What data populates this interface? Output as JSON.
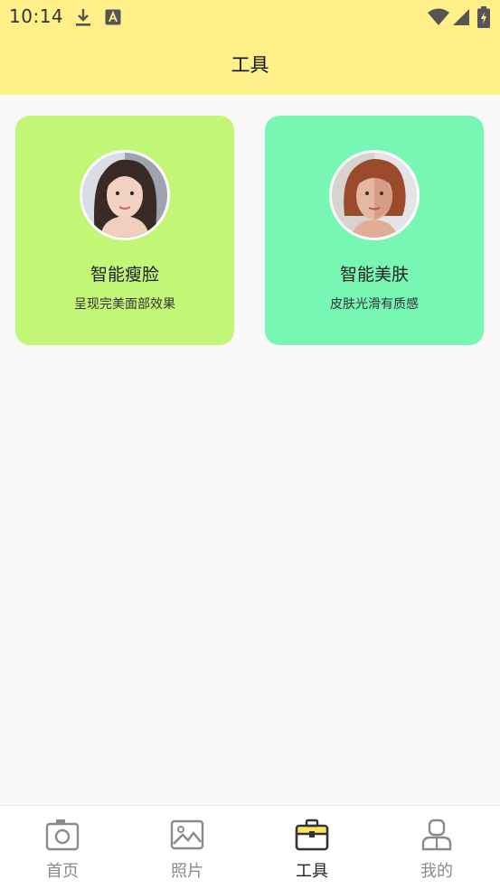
{
  "status_bar": {
    "time": "10:14",
    "icons": [
      "download-icon",
      "text-a-icon",
      "wifi-icon",
      "signal-icon",
      "battery-charging-icon"
    ]
  },
  "header": {
    "title": "工具"
  },
  "tools": [
    {
      "title": "智能瘦脸",
      "subtitle": "呈现完美面部效果",
      "color": "#c2f676",
      "icon": "face-slim-avatar"
    },
    {
      "title": "智能美肤",
      "subtitle": "皮肤光滑有质感",
      "color": "#77f7b3",
      "icon": "skin-beauty-avatar"
    }
  ],
  "bottom_nav": {
    "active_index": 2,
    "items": [
      {
        "label": "首页",
        "icon": "camera-icon"
      },
      {
        "label": "照片",
        "icon": "image-icon"
      },
      {
        "label": "工具",
        "icon": "toolbox-icon"
      },
      {
        "label": "我的",
        "icon": "user-icon"
      }
    ]
  }
}
